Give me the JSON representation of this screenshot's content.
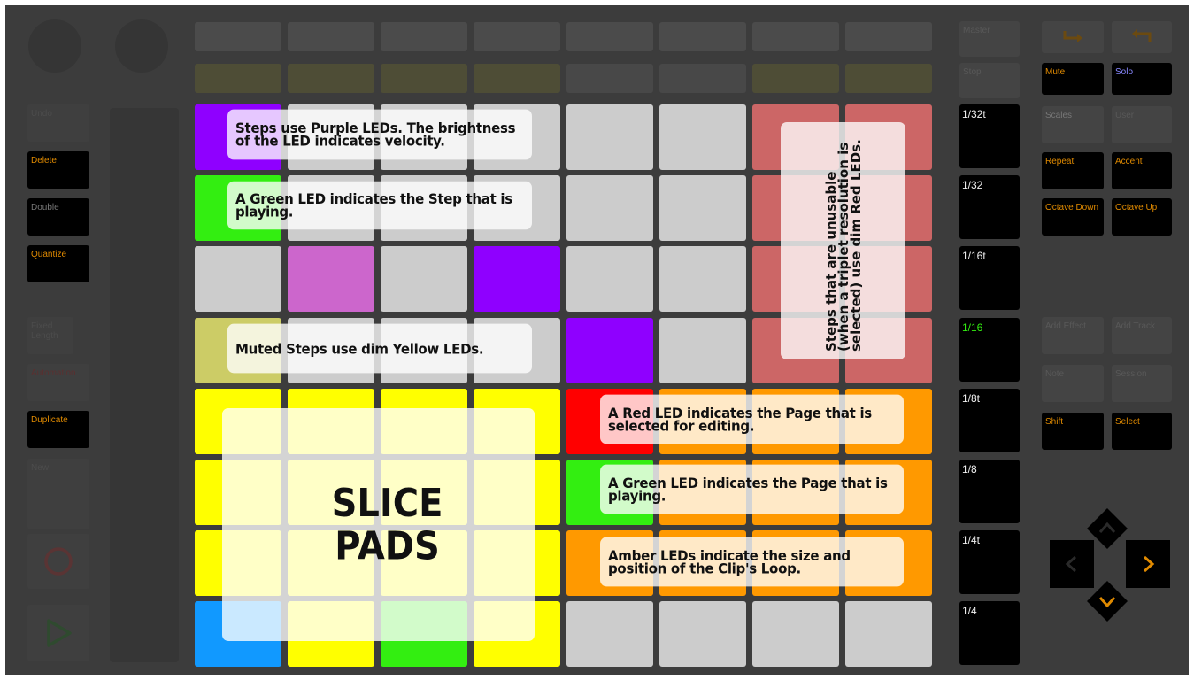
{
  "colors": {
    "device_bg": "#3c3c3c",
    "purple": "#8f00ff",
    "light_purple": "#cc66cc",
    "green": "#33ee11",
    "dim_yellow": "#cccc66",
    "yellow": "#ffff00",
    "blue": "#1199ff",
    "red": "#ff0000",
    "dim_red": "#cc6666",
    "amber": "#ff9900",
    "off": "#cccccc",
    "button_orange": "#e08a00",
    "button_blue": "#8888ff"
  },
  "left_column": {
    "undo": "Undo",
    "delete": "Delete",
    "double": "Double",
    "quantize": "Quantize",
    "fixed_length": "Fixed Length",
    "automation": "Automation",
    "duplicate": "Duplicate",
    "new": "New"
  },
  "scene_column": {
    "master": "Master",
    "stop": "Stop",
    "lengths": [
      "1/32t",
      "1/32",
      "1/16t",
      "1/16",
      "1/8t",
      "1/8",
      "1/4t",
      "1/4"
    ]
  },
  "right_panel": {
    "mute": "Mute",
    "solo": "Solo",
    "scales": "Scales",
    "user": "User",
    "repeat": "Repeat",
    "accent": "Accent",
    "octave_down": "Octave Down",
    "octave_up": "Octave Up",
    "add_effect": "Add Effect",
    "add_track": "Add Track",
    "note": "Note",
    "session": "Session",
    "shift": "Shift",
    "select": "Select"
  },
  "annotations": {
    "purple_steps": "Steps use Purple LEDs. The brightness of the LED indicates velocity.",
    "green_step": "A Green LED indicates the Step that is playing.",
    "muted_steps": "Muted Steps use dim Yellow LEDs.",
    "unusable_steps": "Steps that are unusable (when a triplet resolution is selected) use dim Red LEDs.",
    "slice_pads": "SLICE PADS",
    "red_page": "A Red LED indicates the Page that is selected for editing.",
    "green_page": "A Green LED indicates the Page that is playing.",
    "amber_loop": "Amber LEDs indicate the size and position of the Clip's Loop."
  },
  "grid": [
    [
      "purple",
      "off",
      "off",
      "off",
      "off",
      "off",
      "dim_red",
      "dim_red"
    ],
    [
      "green",
      "off",
      "off",
      "off",
      "off",
      "off",
      "dim_red",
      "dim_red"
    ],
    [
      "off",
      "light_purple",
      "off",
      "purple",
      "off",
      "off",
      "dim_red",
      "dim_red"
    ],
    [
      "dim_yellow",
      "off",
      "off",
      "off",
      "purple",
      "off",
      "dim_red",
      "dim_red"
    ],
    [
      "yellow",
      "yellow",
      "yellow",
      "yellow",
      "red",
      "amber",
      "amber",
      "amber"
    ],
    [
      "yellow",
      "yellow",
      "yellow",
      "yellow",
      "green",
      "amber",
      "amber",
      "amber"
    ],
    [
      "yellow",
      "yellow",
      "yellow",
      "yellow",
      "amber",
      "amber",
      "amber",
      "amber"
    ],
    [
      "blue",
      "yellow",
      "green",
      "yellow",
      "off",
      "off",
      "off",
      "off"
    ]
  ]
}
